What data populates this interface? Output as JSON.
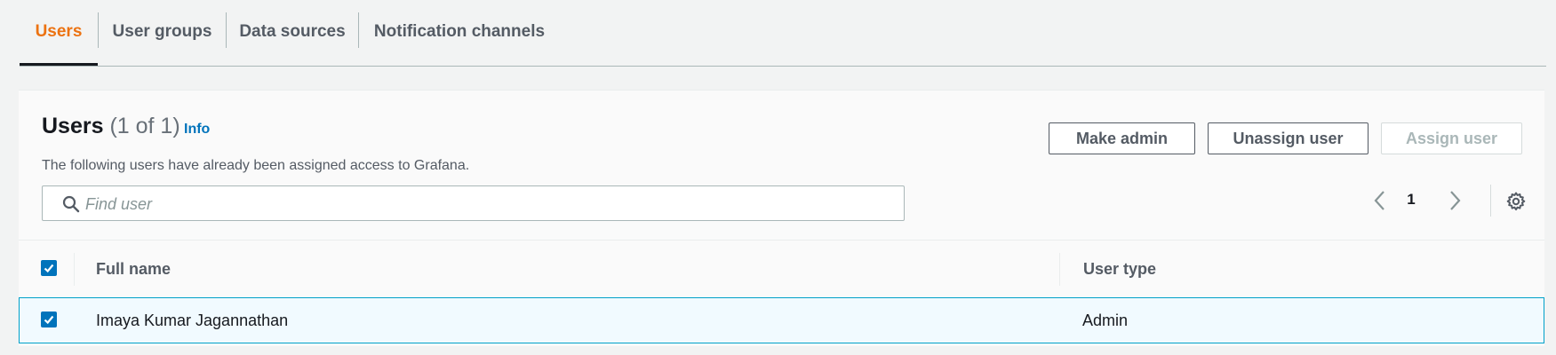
{
  "tabs": [
    {
      "label": "Users",
      "active": true
    },
    {
      "label": "User groups",
      "active": false
    },
    {
      "label": "Data sources",
      "active": false
    },
    {
      "label": "Notification channels",
      "active": false
    }
  ],
  "panel": {
    "title": "Users",
    "count": "(1 of 1)",
    "info_label": "Info",
    "description": "The following users have already been assigned access to Grafana.",
    "search_placeholder": "Find user",
    "search_value": ""
  },
  "actions": {
    "make_admin": "Make admin",
    "unassign_user": "Unassign user",
    "assign_user": "Assign user"
  },
  "pagination": {
    "current_page": "1"
  },
  "table": {
    "columns": [
      "Full name",
      "User type"
    ],
    "select_all_checked": true,
    "rows": [
      {
        "full_name": "Imaya Kumar Jagannathan",
        "user_type": "Admin",
        "selected": true
      }
    ]
  },
  "colors": {
    "accent_tab": "#ec7211",
    "link": "#0073bb",
    "checkbox": "#0073bb",
    "selected_row_bg": "#f1faff",
    "selected_row_border": "#00a1c9"
  },
  "icons": [
    "search-icon",
    "chevron-left-icon",
    "chevron-right-icon",
    "gear-icon",
    "checkmark-icon"
  ]
}
